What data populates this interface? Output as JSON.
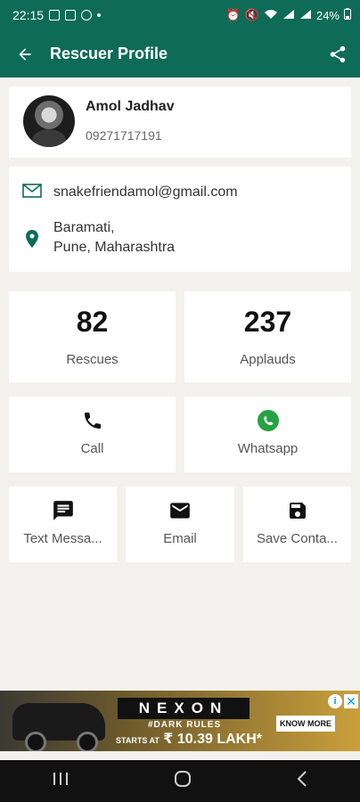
{
  "status_bar": {
    "time": "22:15",
    "battery": "24%"
  },
  "app_bar": {
    "title": "Rescuer Profile",
    "back_icon": "arrow-back-icon",
    "share_icon": "share-icon"
  },
  "profile": {
    "name": "Amol Jadhav",
    "phone": "09271717191"
  },
  "contact": {
    "email": "snakefriendamol@gmail.com",
    "address_line1": "Baramati,",
    "address_line2": "Pune, Maharashtra"
  },
  "stats": {
    "rescues": {
      "value": "82",
      "label": "Rescues"
    },
    "applauds": {
      "value": "237",
      "label": "Applauds"
    }
  },
  "actions": {
    "call": "Call",
    "whatsapp": "Whatsapp",
    "text_message": "Text Messa...",
    "email": "Email",
    "save_contact": "Save Conta..."
  },
  "ad": {
    "brand": "NEXON",
    "tagline": "#DARK RULES",
    "price_prefix": "STARTS AT",
    "price": "₹ 10.39 LAKH*",
    "cta": "KNOW MORE"
  },
  "colors": {
    "primary": "#0e6b58",
    "icon_green": "#0e6b58",
    "whatsapp_green": "#25a244",
    "background": "#f3f1ed"
  }
}
